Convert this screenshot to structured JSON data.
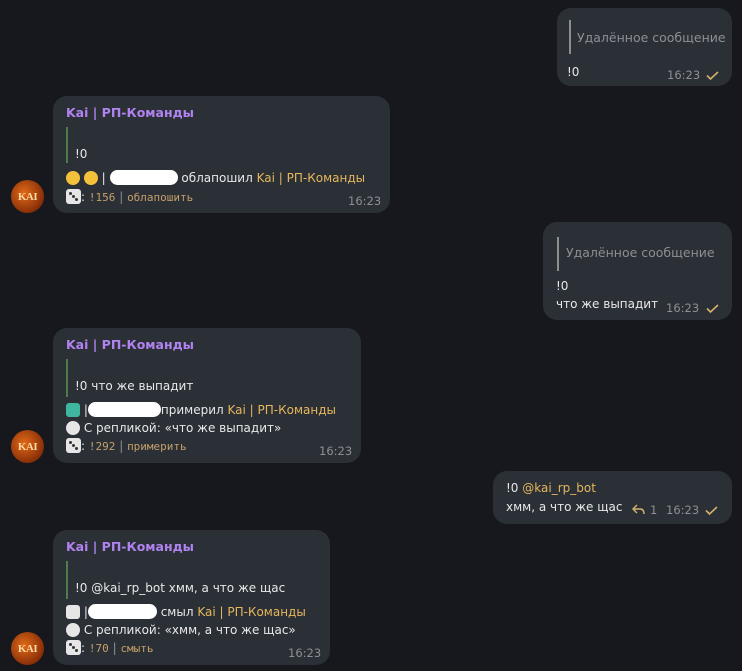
{
  "messages": {
    "m1": {
      "reply_text": "Удалённое сообщение",
      "text": "!0",
      "time": "16:23"
    },
    "m2": {
      "sender": "Kai | РП-Команды",
      "text": "!0",
      "line_action": "облапошил",
      "line_target": "Kai | РП-Команды",
      "line_sep": "|",
      "cmd_counter": "!156",
      "cmd_sep": "|",
      "cmd_name": "облапошить",
      "time": "16:23"
    },
    "m3": {
      "reply_text": "Удалённое сообщение",
      "text1": "!0",
      "text2": "что же выпадит",
      "time": "16:23"
    },
    "m4": {
      "sender": "Kai | РП-Команды",
      "text": "!0 что же выпадит",
      "line_sep": "|",
      "line_action": "примерил",
      "line_target": "Kai | РП-Команды",
      "remark": "С репликой: «что же выпадит»",
      "cmd_counter": "!292",
      "cmd_sep": "|",
      "cmd_name": "примерить",
      "time": "16:23"
    },
    "m5": {
      "text_prefix": "!0 ",
      "mention": "@kai_rp_bot",
      "text2": "хмм, а что же щас",
      "replies": "1",
      "time": "16:23"
    },
    "m6": {
      "sender": "Kai | РП-Команды",
      "text": "!0 @kai_rp_bot  хмм, а что же щас",
      "line_sep": "|",
      "line_action": "смыл",
      "line_target": "Kai | РП-Команды",
      "remark": "С репликой: «хмм, а что же щас»",
      "cmd_counter": "!70",
      "cmd_sep": "|",
      "cmd_name": "смыть",
      "time": "16:23"
    }
  },
  "avatar_text": "KAI",
  "colors": {
    "sender": "#b083f0",
    "link": "#e5b75d",
    "bubble": "#2b2f36",
    "background": "#16181d"
  }
}
